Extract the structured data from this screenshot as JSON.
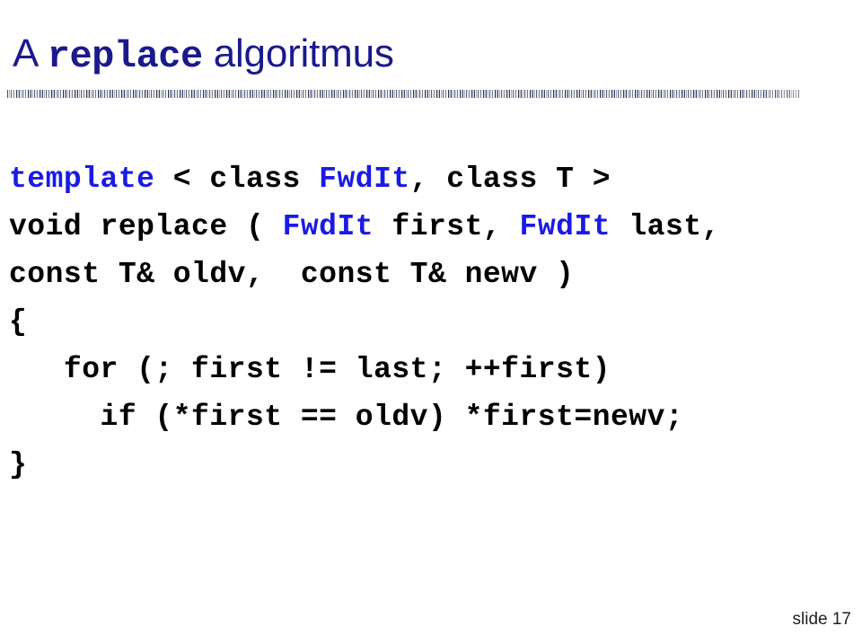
{
  "slide": {
    "title": {
      "prefix": "A ",
      "mono_word": "replace",
      "suffix": " algoritmus",
      "color": "#1a1a8c"
    },
    "divider": {
      "style": "textured-noise-bar",
      "color": "#4c5270"
    },
    "code": {
      "font": "monospace-bold",
      "default_color": "#000000",
      "accent_color": "#1a1ae6",
      "lines": [
        {
          "id": "line-1",
          "text": "template < class FwdIt, class T >",
          "tokens": [
            {
              "text": "template",
              "color": "blue"
            },
            {
              "text": " < class ",
              "color": "black"
            },
            {
              "text": "FwdIt",
              "color": "blue"
            },
            {
              "text": ", class T >",
              "color": "black"
            }
          ]
        },
        {
          "id": "line-2",
          "text": "void replace ( FwdIt first, FwdIt last,",
          "tokens": [
            {
              "text": "void replace ( ",
              "color": "black"
            },
            {
              "text": "FwdIt",
              "color": "blue"
            },
            {
              "text": " first, ",
              "color": "black"
            },
            {
              "text": "FwdIt",
              "color": "blue"
            },
            {
              "text": " last,",
              "color": "black"
            }
          ]
        },
        {
          "id": "line-3",
          "text": "const T& oldv,  const T& newv )",
          "tokens": [
            {
              "text": "const T& oldv,  const T& newv )",
              "color": "black"
            }
          ]
        },
        {
          "id": "line-4",
          "text": "{",
          "tokens": [
            {
              "text": "{",
              "color": "black"
            }
          ]
        },
        {
          "id": "line-5",
          "text": "   for (; first != last; ++first)",
          "tokens": [
            {
              "text": "   for (; first != last; ++first)",
              "color": "black"
            }
          ]
        },
        {
          "id": "line-6",
          "text": "     if (*first == oldv) *first=newv;",
          "tokens": [
            {
              "text": "     if (*first == oldv) *first=newv;",
              "color": "black"
            }
          ]
        },
        {
          "id": "line-7",
          "text": "}",
          "tokens": [
            {
              "text": "}",
              "color": "black"
            }
          ]
        }
      ]
    },
    "footer": {
      "slide_number_label": "slide 17"
    }
  }
}
